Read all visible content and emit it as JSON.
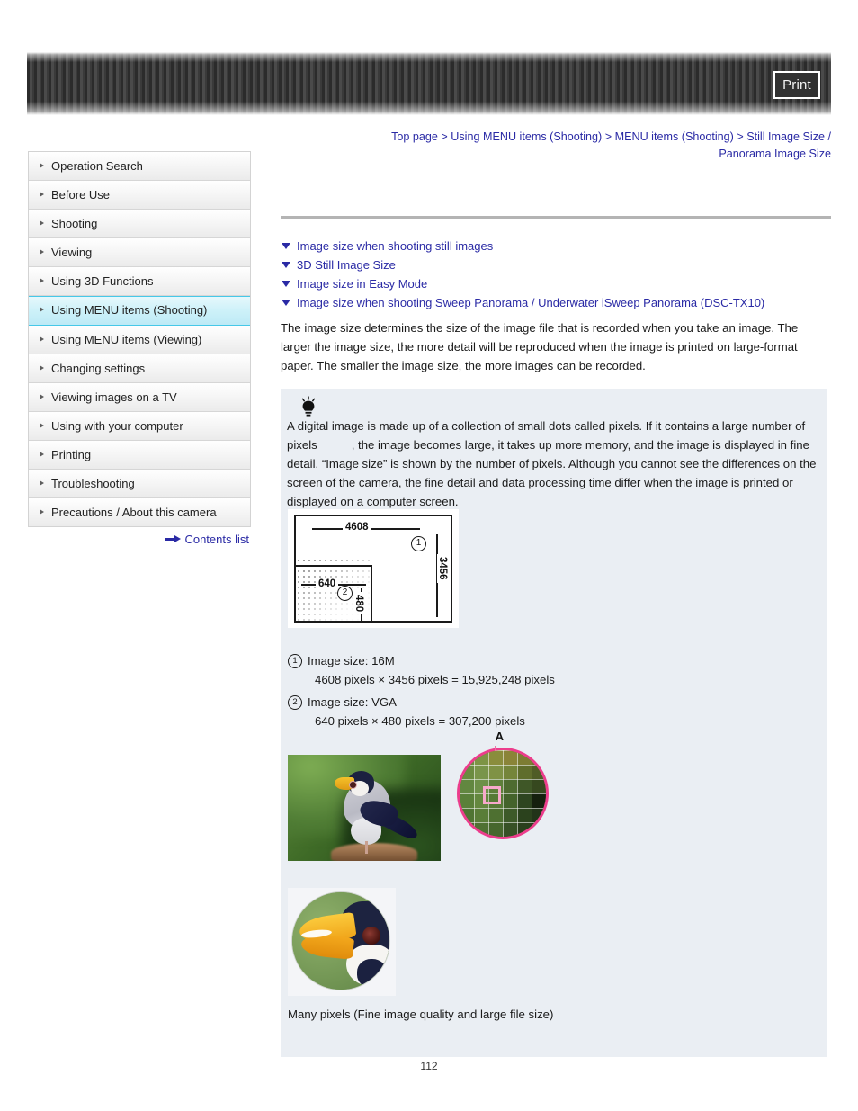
{
  "header": {
    "print_label": "Print"
  },
  "breadcrumb": {
    "items": [
      "Top page",
      "Using MENU items (Shooting)",
      "MENU items (Shooting)",
      "Still Image Size / Panorama Image Size"
    ],
    "separator": ">",
    "line1": "Top page > Using MENU items (Shooting) > MENU items (Shooting) > Still Image Size /",
    "line2": "Panorama Image Size"
  },
  "sidebar": {
    "items": [
      {
        "label": "Operation Search",
        "active": false
      },
      {
        "label": "Before Use",
        "active": false
      },
      {
        "label": "Shooting",
        "active": false
      },
      {
        "label": "Viewing",
        "active": false
      },
      {
        "label": "Using 3D Functions",
        "active": false
      },
      {
        "label": "Using MENU items (Shooting)",
        "active": true
      },
      {
        "label": "Using MENU items (Viewing)",
        "active": false
      },
      {
        "label": "Changing settings",
        "active": false
      },
      {
        "label": "Viewing images on a TV",
        "active": false
      },
      {
        "label": "Using with your computer",
        "active": false
      },
      {
        "label": "Printing",
        "active": false
      },
      {
        "label": "Troubleshooting",
        "active": false
      },
      {
        "label": "Precautions / About this camera",
        "active": false
      }
    ],
    "contents_link": "Contents list"
  },
  "main": {
    "anchors": [
      "Image size when shooting still images",
      "3D Still Image Size",
      "Image size in Easy Mode",
      "Image size when shooting Sweep Panorama / Underwater iSweep Panorama (DSC-TX10)"
    ],
    "intro": "The image size determines the size of the image file that is recorded when you take an image. The larger the image size, the more detail will be reproduced when the image is printed on large-format paper. The smaller the image size, the more images can be recorded."
  },
  "tip": {
    "icon": "lightbulb-icon",
    "text_part1": "A digital image is made up of a collection of small dots called pixels. If it contains a large number of pixels",
    "text_part2": ", the image becomes large, it takes up more memory, and the image is displayed in fine detail. “Image size” is shown by the number of pixels. Although you cannot see the differences on the screen of the camera, the fine detail and data processing time differ when the image is printed or displayed on a computer screen."
  },
  "diagram": {
    "outer_width_label": "4608",
    "outer_height_label": "3456",
    "inner_width_label": "640",
    "inner_height_label": "480",
    "marker_one": "1",
    "marker_two": "2"
  },
  "legend": [
    {
      "marker": "1",
      "title": "Image size: 16M",
      "detail": "4608 pixels × 3456 pixels = 15,925,248 pixels"
    },
    {
      "marker": "2",
      "title": "Image size: VGA",
      "detail": "640 pixels × 480 pixels = 307,200 pixels"
    }
  ],
  "photo": {
    "magnifier_label": "A",
    "caption": "Many pixels (Fine image quality and large file size)"
  },
  "footer": {
    "page_number": "112"
  },
  "colors": {
    "link": "#2a2aa5",
    "active_nav": "#cdf1f9",
    "active_nav_border": "#46c8e8",
    "tip_background": "#eaeef3",
    "magnifier_pink": "#ec3d8c",
    "header_dark": "#2b2b2b"
  }
}
